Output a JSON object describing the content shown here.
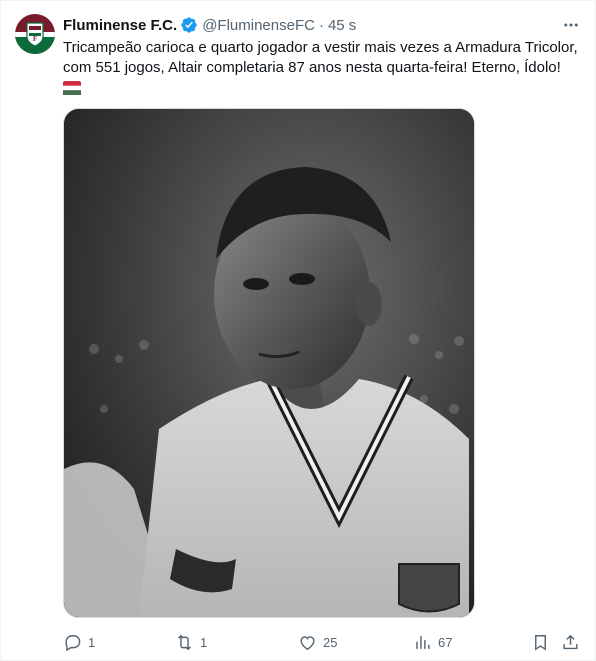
{
  "post": {
    "author_name": "Fluminense F.C.",
    "handle": "@FluminenseFC",
    "separator": "·",
    "time": "45 s",
    "text": "Tricampeão carioca e quarto jogador a vestir mais vezes a Armadura Tricolor, com 551 jogos, Altair completaria 87 anos nesta quarta-feira! Eterno, Ídolo!",
    "flag_icon": "hungary-flag-emoji",
    "media": {
      "description": "black-and-white-portrait-photo"
    }
  },
  "actions": {
    "replies": "1",
    "reposts": "1",
    "likes": "25",
    "views": "67"
  },
  "colors": {
    "text": "#0f1419",
    "secondary": "#536471",
    "verified": "#1d9bf0",
    "club_maroon": "#7a1b2c",
    "club_green": "#0b6b3a"
  }
}
